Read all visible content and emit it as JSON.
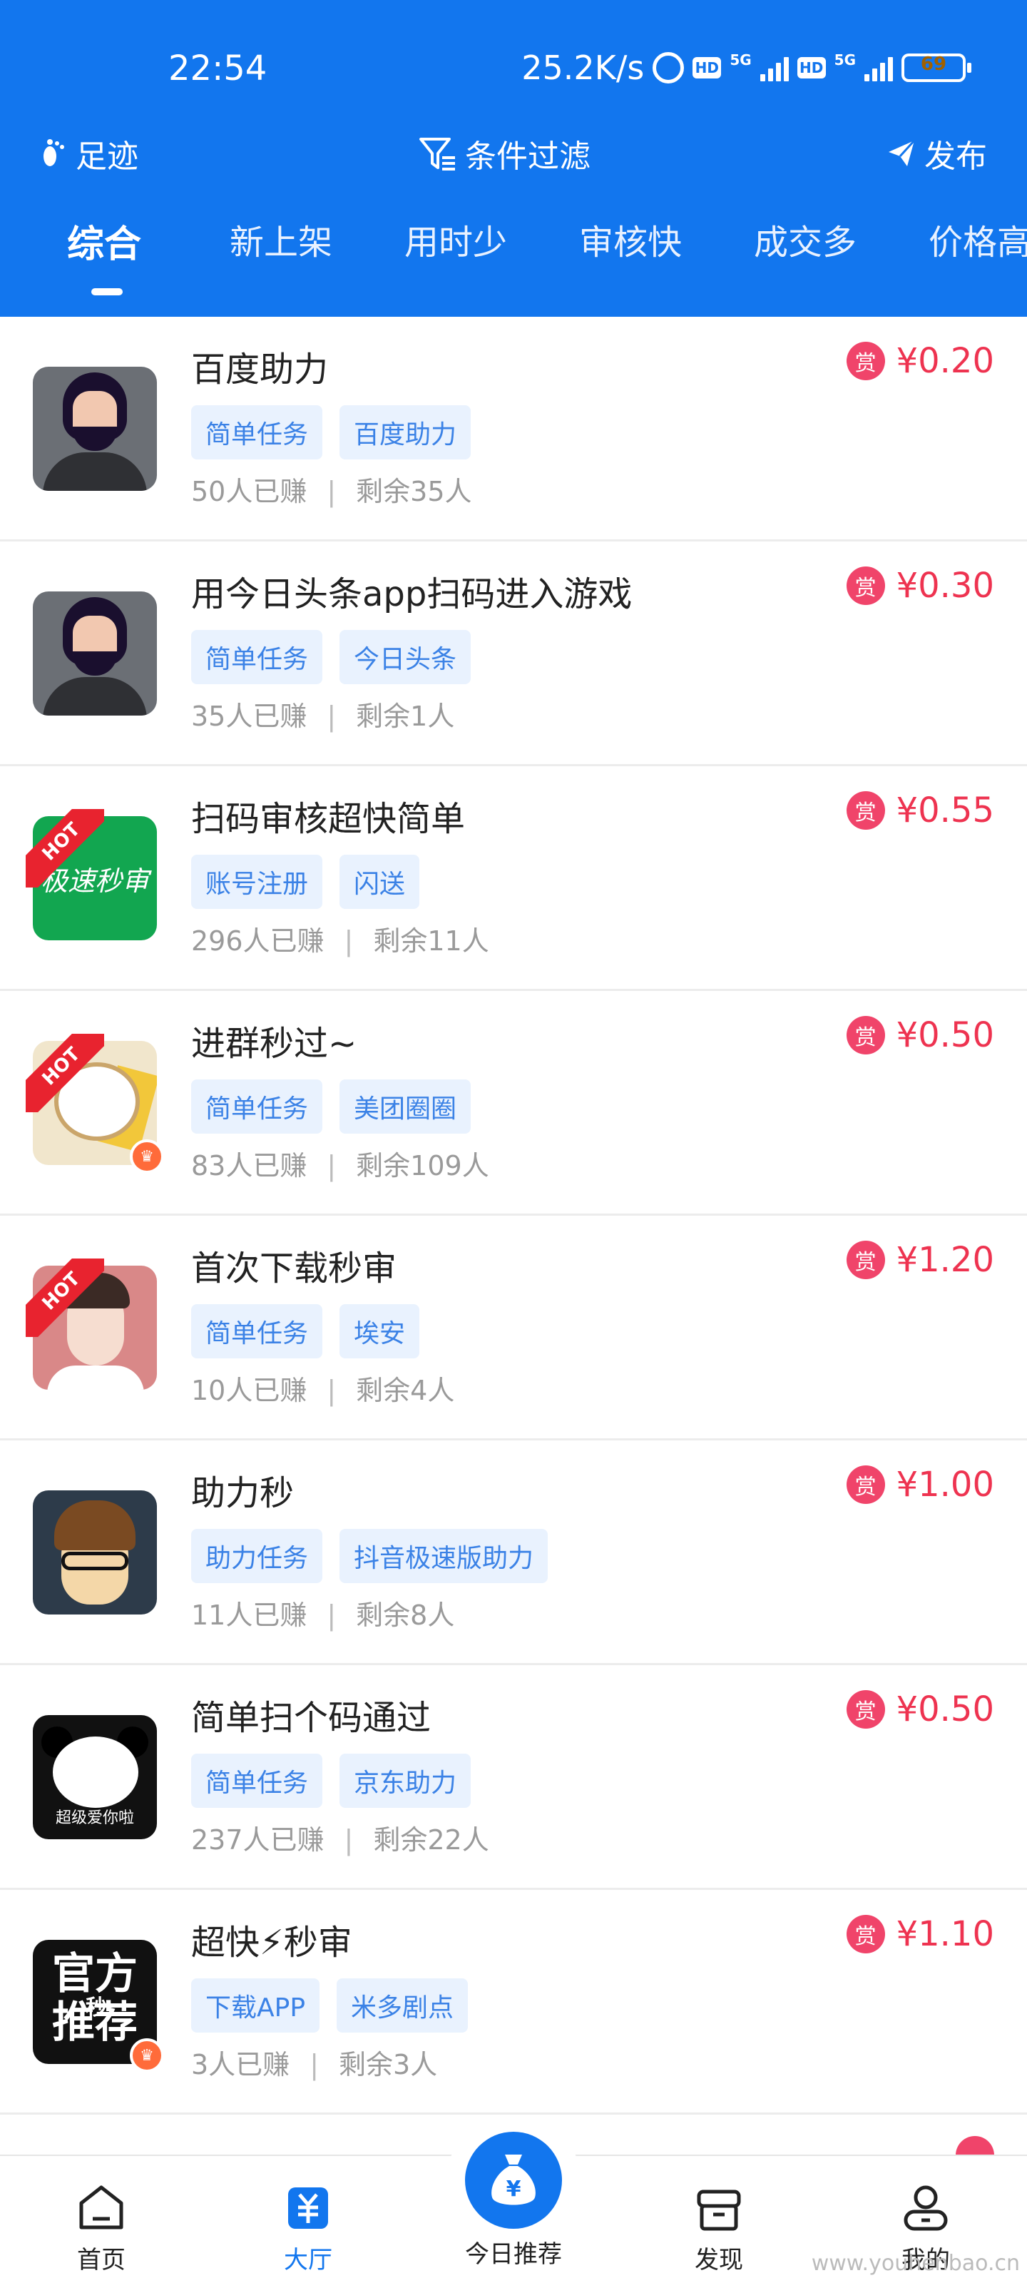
{
  "status_bar": {
    "time": "22:54",
    "speed": "25.2K/s",
    "hd1": "HD",
    "sig1": "5G",
    "hd2": "HD",
    "sig2": "5G",
    "battery": "69"
  },
  "toolbar": {
    "footprint": "足迹",
    "filter": "条件过滤",
    "publish": "发布"
  },
  "tabs": [
    "综合",
    "新上架",
    "用时少",
    "审核快",
    "成交多",
    "价格高"
  ],
  "items": [
    {
      "title": "百度助力",
      "tags": [
        "简单任务",
        "百度助力"
      ],
      "earned": "50人已赚",
      "remaining": "剩余35人",
      "reward_label": "赏",
      "price": "¥0.20"
    },
    {
      "title": "用今日头条app扫码进入游戏",
      "tags": [
        "简单任务",
        "今日头条"
      ],
      "earned": "35人已赚",
      "remaining": "剩余1人",
      "reward_label": "赏",
      "price": "¥0.30"
    },
    {
      "title": "扫码审核超快简单",
      "tags": [
        "账号注册",
        "闪送"
      ],
      "earned": "296人已赚",
      "remaining": "剩余11人",
      "reward_label": "赏",
      "price": "¥0.55",
      "hot": "HOT",
      "avatar_text": "极速秒审"
    },
    {
      "title": "进群秒过~",
      "tags": [
        "简单任务",
        "美团圈圈"
      ],
      "earned": "83人已赚",
      "remaining": "剩余109人",
      "reward_label": "赏",
      "price": "¥0.50",
      "hot": "HOT"
    },
    {
      "title": "首次下载秒审",
      "tags": [
        "简单任务",
        "埃安"
      ],
      "earned": "10人已赚",
      "remaining": "剩余4人",
      "reward_label": "赏",
      "price": "¥1.20",
      "hot": "HOT"
    },
    {
      "title": "助力秒",
      "tags": [
        "助力任务",
        "抖音极速版助力"
      ],
      "earned": "11人已赚",
      "remaining": "剩余8人",
      "reward_label": "赏",
      "price": "¥1.00"
    },
    {
      "title": "简单扫个码通过",
      "tags": [
        "简单任务",
        "京东助力"
      ],
      "earned": "237人已赚",
      "remaining": "剩余22人",
      "reward_label": "赏",
      "price": "¥0.50",
      "avatar_text": "超级爱你啦"
    },
    {
      "title": "超快⚡秒审",
      "tags": [
        "下载APP",
        "米多剧点"
      ],
      "earned": "3人已赚",
      "remaining": "剩余3人",
      "reward_label": "赏",
      "price": "¥1.10",
      "avatar_text_top": "官方",
      "avatar_text_mid": "秒",
      "avatar_text_bottom": "推荐"
    }
  ],
  "bottom_nav": {
    "home": "首页",
    "hall": "大厅",
    "today": "今日推荐",
    "discover": "发现",
    "mine": "我的"
  },
  "colors": {
    "primary": "#1276ee",
    "price": "#ee3350",
    "tag_bg": "#e9f2fe"
  },
  "watermark": "www.youhenbao.cn"
}
